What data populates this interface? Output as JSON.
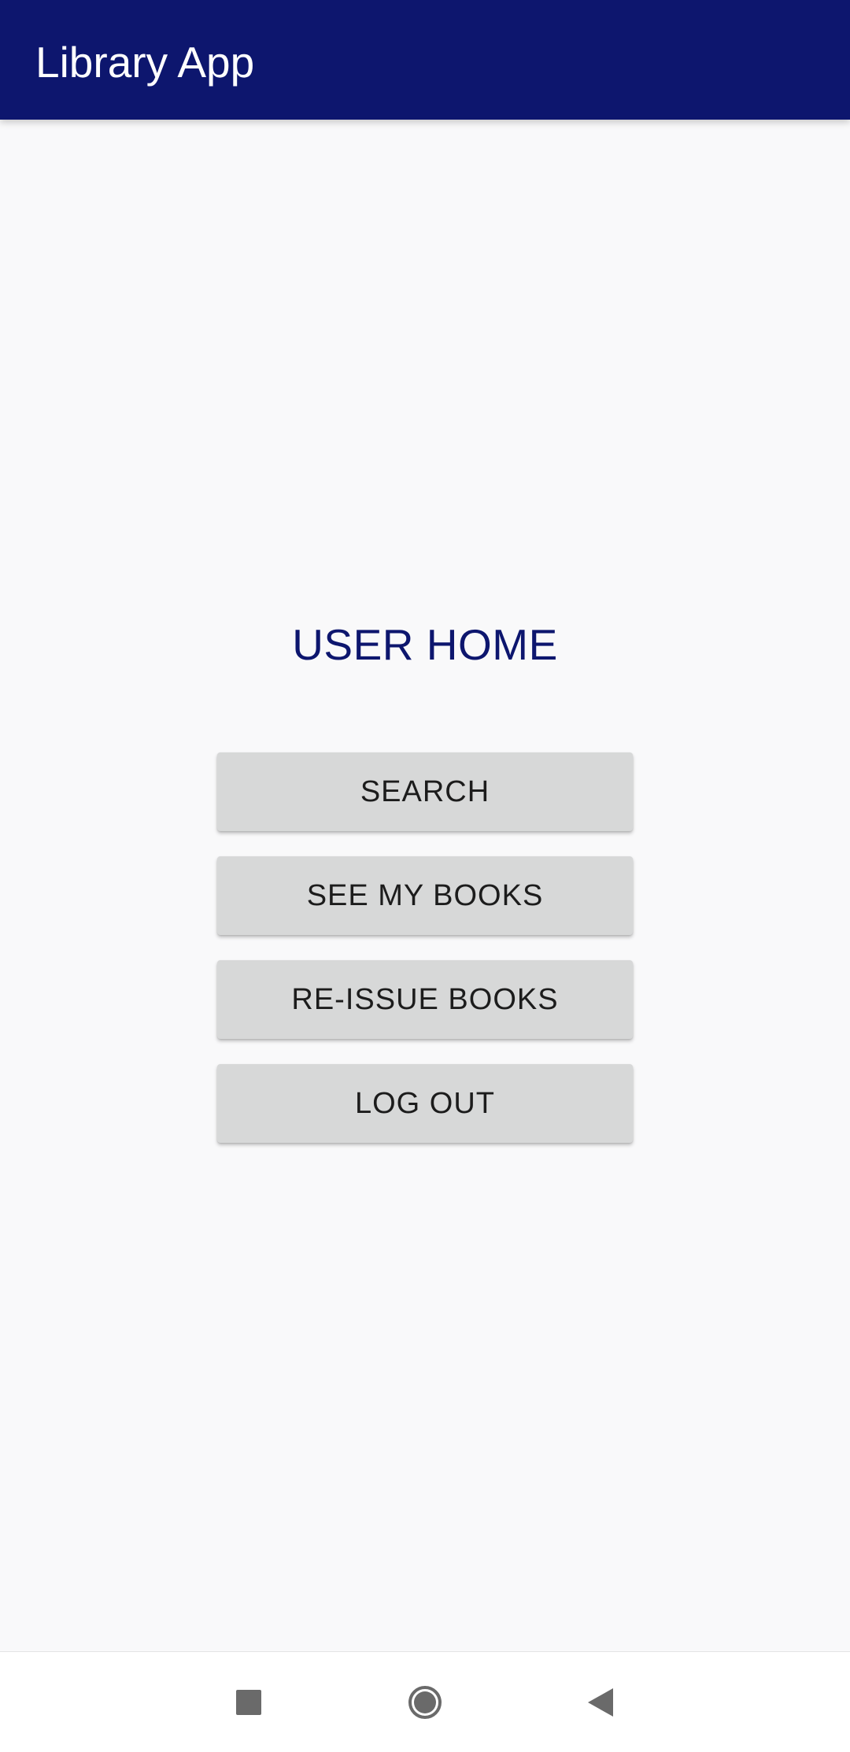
{
  "app_bar": {
    "title": "Library App",
    "color": "#0d166e"
  },
  "main": {
    "heading": "USER HOME",
    "buttons": [
      {
        "label": "SEARCH"
      },
      {
        "label": "SEE MY BOOKS"
      },
      {
        "label": "RE-ISSUE BOOKS"
      },
      {
        "label": "LOG OUT"
      }
    ]
  },
  "nav_bar": {
    "icons": [
      "recents-icon",
      "home-icon",
      "back-icon"
    ]
  }
}
